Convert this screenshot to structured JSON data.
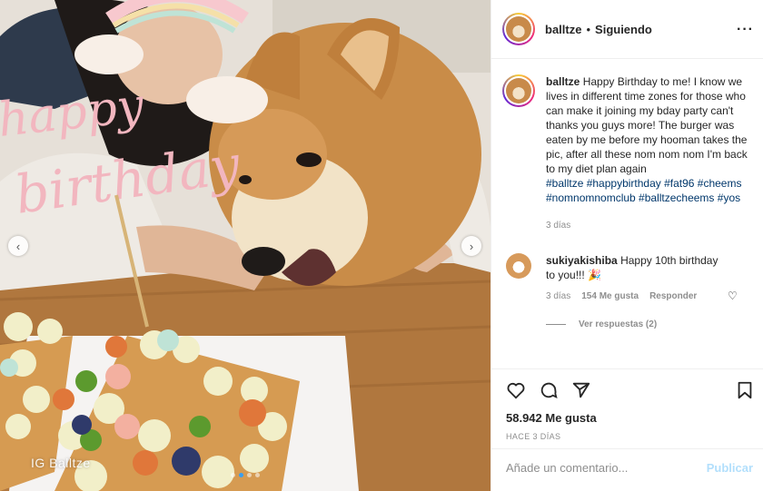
{
  "post": {
    "watermark": "IG Balltze",
    "carousel_dots": 4,
    "active_dot": 1
  },
  "header": {
    "username": "balltze",
    "separator": "•",
    "follow_status": "Siguiendo",
    "more_icon": "ellipsis-icon"
  },
  "caption": {
    "username": "balltze",
    "text": "Happy Birthday to me! I know we lives in different time zones for those who can make it joining my bday party can't thanks you guys more! The burger was eaten by me before my hooman takes the pic, after all these nom nom nom I'm back to my diet plan again",
    "hashtags": "#balltze #happybirthday #fat96 #cheems #nomnomnomclub #balltzecheems #yos",
    "time": "3 días"
  },
  "comment": {
    "username": "sukiyakishiba",
    "text": "Happy 10th birthday to you!!! 🎉",
    "time": "3 días",
    "likes": "154 Me gusta",
    "reply": "Responder",
    "view_replies": "Ver respuestas (2)"
  },
  "actions": {
    "likes": "58.942 Me gusta",
    "ago": "HACE 3 DÍAS",
    "comment_placeholder": "Añade un comentario...",
    "publish": "Publicar"
  },
  "colors": {
    "link": "#00376b",
    "muted": "#8e8e8e",
    "publish_disabled": "#b2dffc"
  }
}
